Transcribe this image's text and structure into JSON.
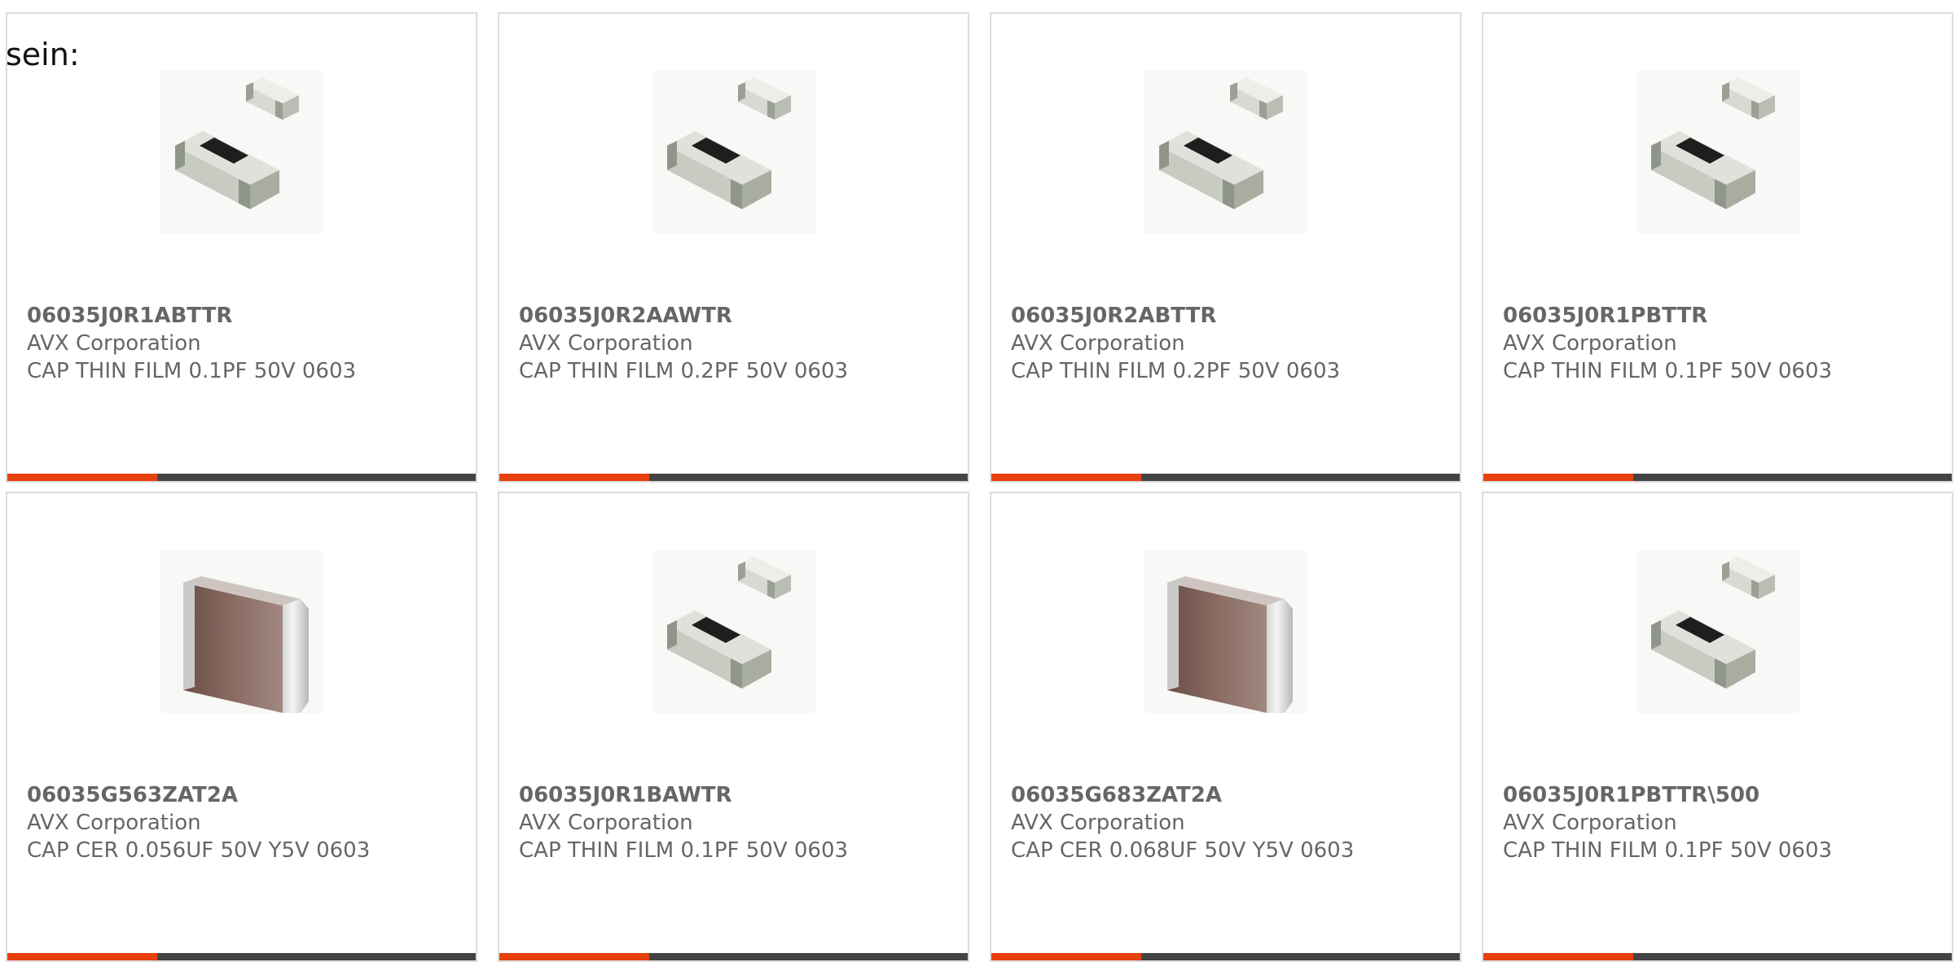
{
  "intro_text": "sein:",
  "colors": {
    "accent": "#e8400c",
    "bar": "#444444",
    "text": "#666666",
    "card_border": "#dcdcdc"
  },
  "products": [
    {
      "part_number": "06035J0R1ABTTR",
      "manufacturer": "AVX Corporation",
      "description": "CAP THIN FILM 0.1PF 50V 0603",
      "image": "thin-film-cap-image"
    },
    {
      "part_number": "06035J0R2AAWTR",
      "manufacturer": "AVX Corporation",
      "description": "CAP THIN FILM 0.2PF 50V 0603",
      "image": "thin-film-cap-image"
    },
    {
      "part_number": "06035J0R2ABTTR",
      "manufacturer": "AVX Corporation",
      "description": "CAP THIN FILM 0.2PF 50V 0603",
      "image": "thin-film-cap-image"
    },
    {
      "part_number": "06035J0R1PBTTR",
      "manufacturer": "AVX Corporation",
      "description": "CAP THIN FILM 0.1PF 50V 0603",
      "image": "thin-film-cap-image"
    },
    {
      "part_number": "06035G563ZAT2A",
      "manufacturer": "AVX Corporation",
      "description": "CAP CER 0.056UF 50V Y5V 0603",
      "image": "ceramic-cap-image"
    },
    {
      "part_number": "06035J0R1BAWTR",
      "manufacturer": "AVX Corporation",
      "description": "CAP THIN FILM 0.1PF 50V 0603",
      "image": "thin-film-cap-image"
    },
    {
      "part_number": "06035G683ZAT2A",
      "manufacturer": "AVX Corporation",
      "description": "CAP CER 0.068UF 50V Y5V 0603",
      "image": "ceramic-cap-image"
    },
    {
      "part_number": "06035J0R1PBTTR\\500",
      "manufacturer": "AVX Corporation",
      "description": "CAP THIN FILM 0.1PF 50V 0603",
      "image": "thin-film-cap-image"
    }
  ]
}
